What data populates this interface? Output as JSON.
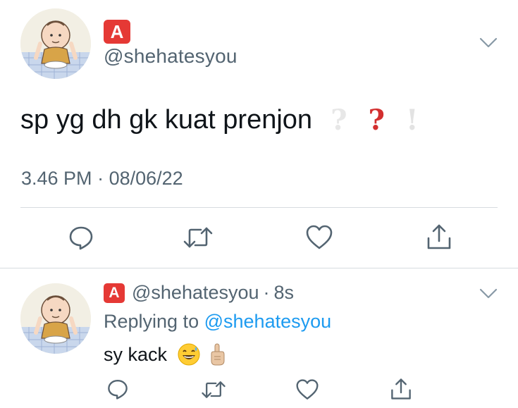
{
  "tweet": {
    "badge_letter": "A",
    "handle": "@shehatesyou",
    "text": "sp yg dh gk kuat prenjon",
    "trailing_marks": [
      "?",
      "?",
      "!"
    ],
    "time": "3.46 PM",
    "date_sep": "·",
    "date": "08/06/22",
    "avatar_icon": "cartoon-character-avatar",
    "menu_icon": "chevron-down-icon",
    "actions": [
      {
        "name": "reply",
        "icon": "speech-bubble-icon"
      },
      {
        "name": "retweet",
        "icon": "retweet-icon"
      },
      {
        "name": "like",
        "icon": "heart-icon"
      },
      {
        "name": "share",
        "icon": "share-icon"
      }
    ]
  },
  "reply": {
    "badge_letter": "A",
    "handle": "@shehatesyou",
    "sep": "·",
    "age": "8s",
    "replying_prefix": "Replying to",
    "replying_to": "@shehatesyou",
    "text": "sy kack",
    "emojis": [
      "grinning-sweat-emoji",
      "pointing-up-emoji"
    ]
  },
  "colors": {
    "text": "#0f1419",
    "secondary": "#536471",
    "link": "#1d9bf0",
    "badge_red": "#e53935",
    "divider": "#d7dbdf"
  }
}
